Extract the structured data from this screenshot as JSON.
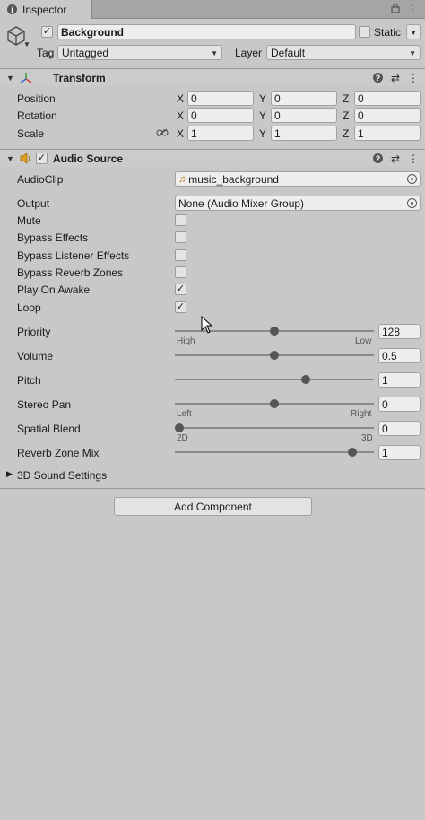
{
  "tab": {
    "title": "Inspector",
    "lock_icon": "lock-icon",
    "menu_icon": "kebab-menu-icon"
  },
  "object": {
    "active": true,
    "name": "Background",
    "static_label": "Static",
    "static_checked": false,
    "tag_label": "Tag",
    "tag_value": "Untagged",
    "layer_label": "Layer",
    "layer_value": "Default"
  },
  "transform": {
    "title": "Transform",
    "position": {
      "label": "Position",
      "x": "0",
      "y": "0",
      "z": "0"
    },
    "rotation": {
      "label": "Rotation",
      "x": "0",
      "y": "0",
      "z": "0"
    },
    "scale": {
      "label": "Scale",
      "x": "1",
      "y": "1",
      "z": "1"
    },
    "axis_x": "X",
    "axis_y": "Y",
    "axis_z": "Z"
  },
  "audio_source": {
    "title": "Audio Source",
    "enabled": true,
    "audio_clip_label": "AudioClip",
    "audio_clip_value": "music_background",
    "output_label": "Output",
    "output_value": "None (Audio Mixer Group)",
    "mute_label": "Mute",
    "mute_checked": false,
    "bypass_effects_label": "Bypass Effects",
    "bypass_effects_checked": false,
    "bypass_listener_label": "Bypass Listener Effects",
    "bypass_listener_checked": false,
    "bypass_reverb_label": "Bypass Reverb Zones",
    "bypass_reverb_checked": false,
    "play_on_awake_label": "Play On Awake",
    "play_on_awake_checked": true,
    "loop_label": "Loop",
    "loop_checked": true,
    "priority": {
      "label": "Priority",
      "value": "128",
      "fraction": 0.5,
      "min_label": "High",
      "max_label": "Low"
    },
    "volume": {
      "label": "Volume",
      "value": "0.5",
      "fraction": 0.5
    },
    "pitch": {
      "label": "Pitch",
      "value": "1",
      "fraction": 0.667
    },
    "stereo_pan": {
      "label": "Stereo Pan",
      "value": "0",
      "fraction": 0.5,
      "min_label": "Left",
      "max_label": "Right"
    },
    "spatial_blend": {
      "label": "Spatial Blend",
      "value": "0",
      "fraction": 0.0,
      "min_label": "2D",
      "max_label": "3D"
    },
    "reverb_zone_mix": {
      "label": "Reverb Zone Mix",
      "value": "1",
      "fraction": 0.909
    },
    "sound_settings_label": "3D Sound Settings"
  },
  "add_component_label": "Add Component",
  "checkmark": "✓"
}
